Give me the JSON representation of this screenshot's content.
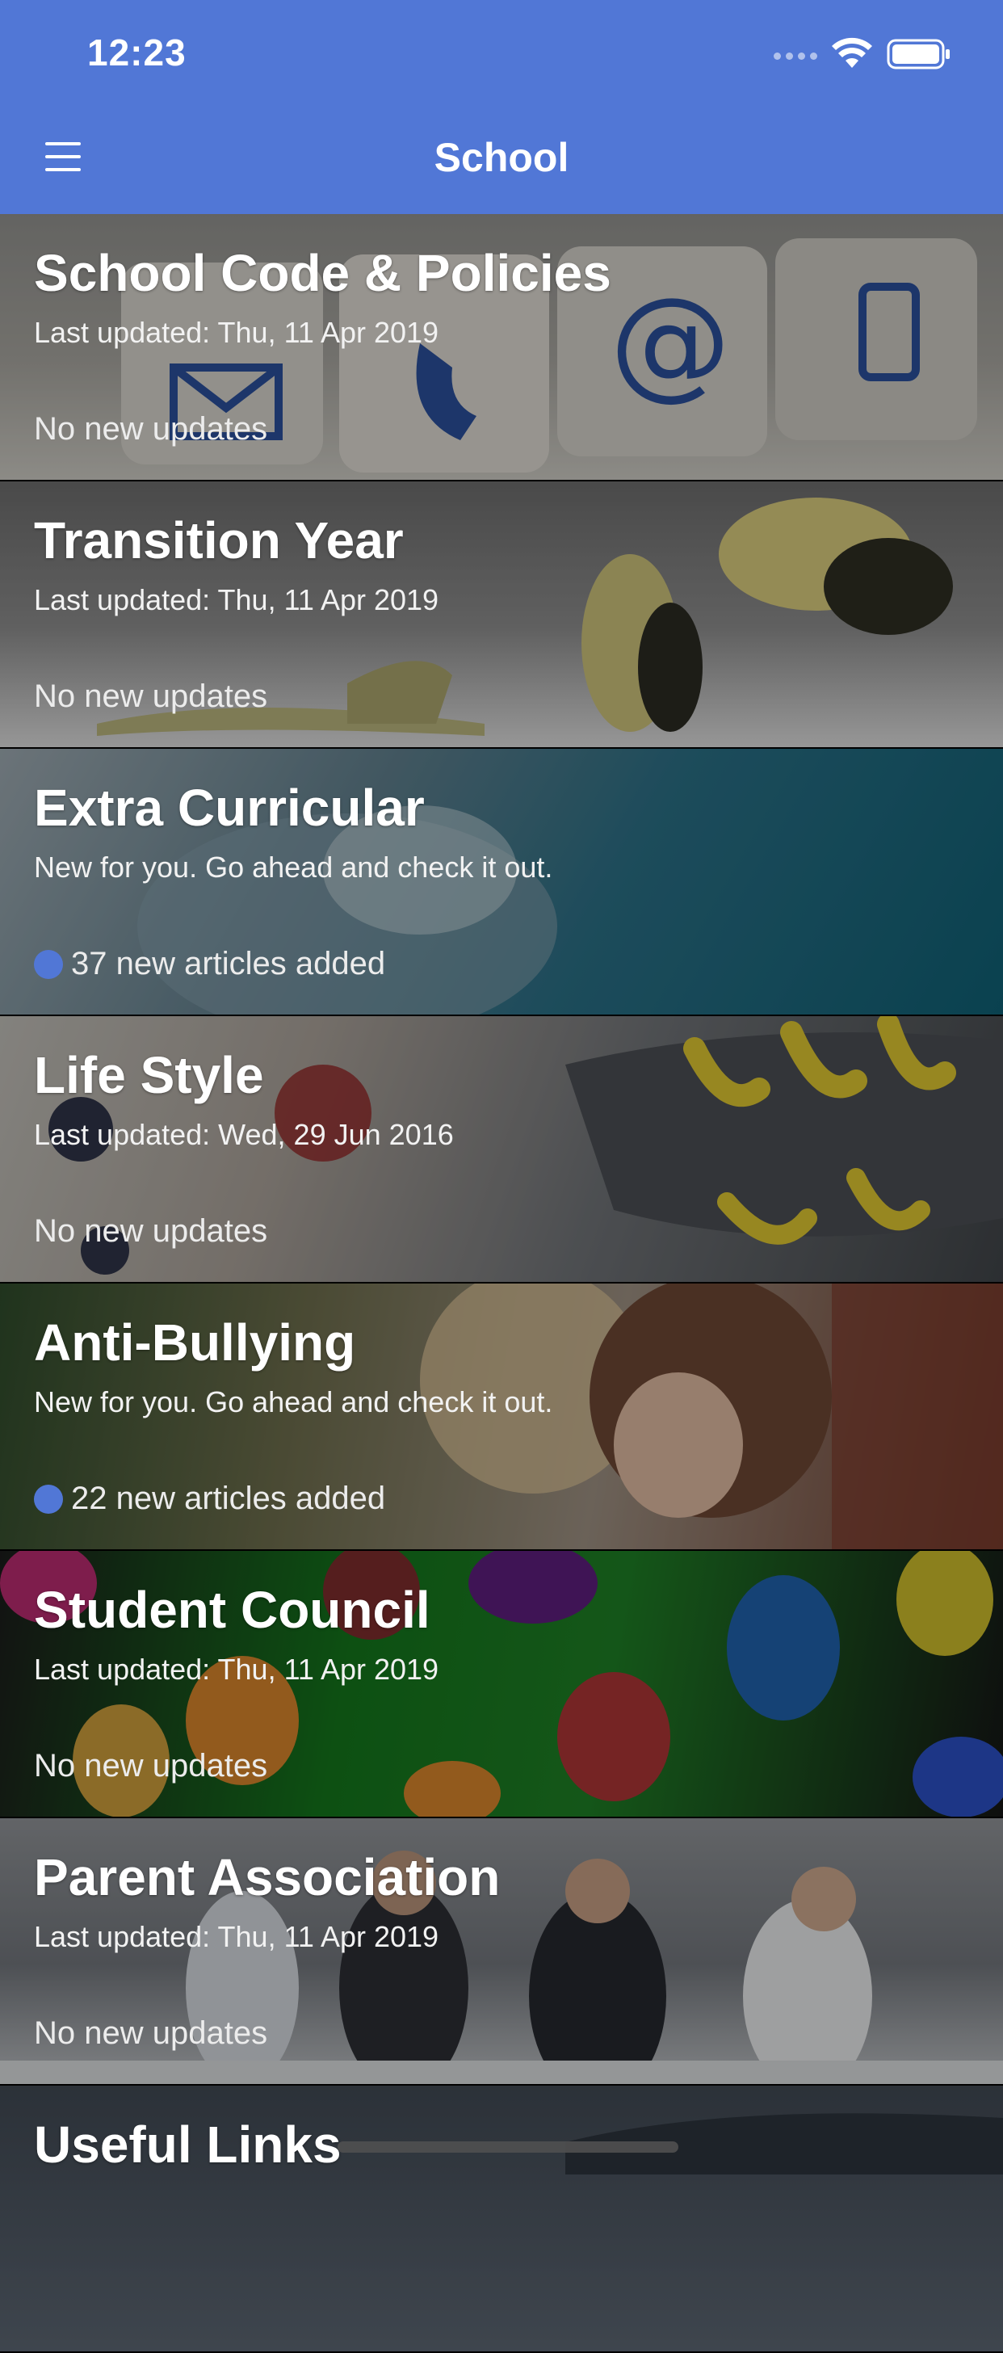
{
  "status_bar": {
    "time": "12:23"
  },
  "header": {
    "title": "School"
  },
  "sections": [
    {
      "title": "School Code & Policies",
      "subtitle": "Last updated: Thu, 11 Apr 2019",
      "status": "No new updates"
    },
    {
      "title": "Transition Year",
      "subtitle": "Last updated: Thu, 11 Apr 2019",
      "status": "No new updates"
    },
    {
      "title": "Extra Curricular",
      "subtitle": "New for you. Go ahead and check it out.",
      "status": "37 new articles added"
    },
    {
      "title": "Life Style",
      "subtitle": "Last updated: Wed, 29 Jun 2016",
      "status": "No new updates"
    },
    {
      "title": "Anti-Bullying",
      "subtitle": "New for you. Go ahead and check it out.",
      "status": "22 new articles added"
    },
    {
      "title": "Student Council",
      "subtitle": "Last updated: Thu, 11 Apr 2019",
      "status": "No new updates"
    },
    {
      "title": "Parent Association",
      "subtitle": "Last updated: Thu, 11 Apr 2019",
      "status": "No new updates"
    },
    {
      "title": "Useful Links"
    }
  ],
  "colors": {
    "accent": "#5177D6"
  }
}
